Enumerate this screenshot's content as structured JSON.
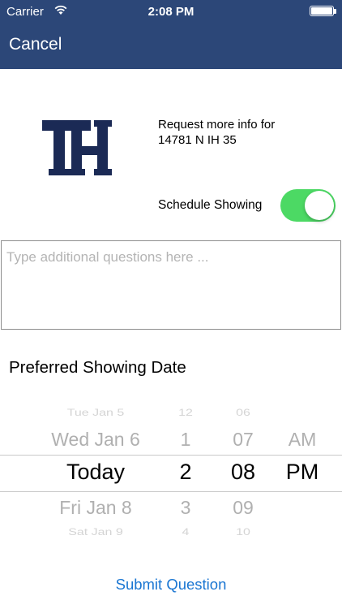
{
  "status_bar": {
    "carrier": "Carrier",
    "time": "2:08 PM",
    "icons": [
      "wifi-icon",
      "battery-icon"
    ]
  },
  "nav": {
    "cancel_label": "Cancel",
    "bar_color": "#2c4778"
  },
  "header": {
    "logo_text": "TH",
    "logo_color": "#1b2a55",
    "request_line1": "Request more info for",
    "request_line2": "14781 N IH 35"
  },
  "schedule": {
    "label": "Schedule Showing",
    "enabled": true,
    "toggle_color": "#4cd964"
  },
  "questions": {
    "placeholder": "Type additional questions here ...",
    "value": ""
  },
  "preferred_date": {
    "title": "Preferred Showing Date"
  },
  "picker": {
    "dates": [
      "Tue Jan 5",
      "Wed Jan 6",
      "Today",
      "Fri Jan 8",
      "Sat Jan 9"
    ],
    "hours": [
      "12",
      "1",
      "2",
      "3",
      "4"
    ],
    "minutes": [
      "06",
      "07",
      "08",
      "09",
      "10"
    ],
    "ampm": [
      "",
      "AM",
      "PM",
      "",
      ""
    ],
    "selected": {
      "date": "Today",
      "hour": "2",
      "minute": "08",
      "ampm": "PM"
    }
  },
  "submit": {
    "label": "Submit Question",
    "color": "#1a76d2"
  }
}
